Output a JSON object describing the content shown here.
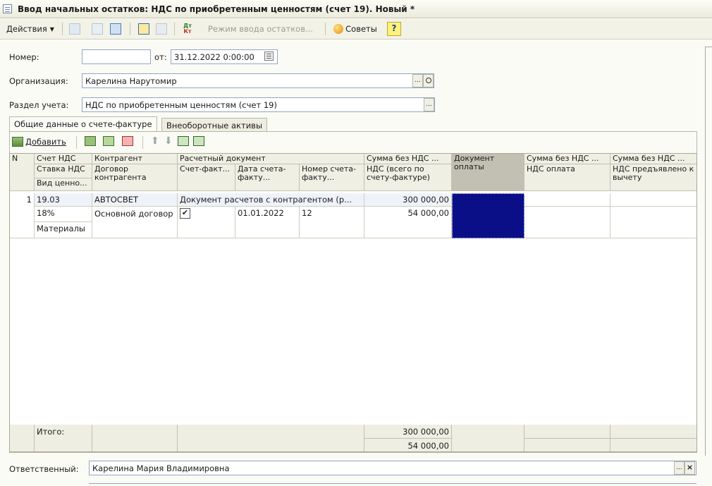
{
  "window": {
    "title": "Ввод начальных остатков: НДС по приобретенным ценностям (счет 19). Новый *"
  },
  "toolbar": {
    "actions_label": "Действия",
    "input_mode_label": "Режим ввода остатков...",
    "tips_label": "Советы",
    "help_label": "?",
    "dtkt_top": "Дт",
    "dtkt_bottom": "Кт"
  },
  "form": {
    "number_label": "Номер:",
    "number_value": "",
    "date_label": "от:",
    "date_value": "31.12.2022  0:00:00",
    "org_label": "Организация:",
    "org_value": "Карелина Нарутомир",
    "section_label": "Раздел учета:",
    "section_value": "НДС по приобретенным ценностям (счет 19)",
    "responsible_label": "Ответственный:",
    "responsible_value": "Карелина Мария Владимировна",
    "select_glyph": "...",
    "clear_glyph": "×"
  },
  "tabs": [
    {
      "label": "Общие данные о счете-фактуре"
    },
    {
      "label": "Внеоборотные активы"
    }
  ],
  "grid_toolbar": {
    "add_label": "Добавить"
  },
  "grid": {
    "headers": {
      "n": "N",
      "account": "Счет НДС",
      "rate": "Ставка НДС",
      "valuable_type": "Вид ценно...",
      "counterparty": "Контрагент",
      "contract": "Договор контрагента",
      "settlement_doc": "Расчетный документ",
      "invoice": "Счет-факт...",
      "invoice_date": "Дата счета-факту...",
      "invoice_number": "Номер счета-факту...",
      "sum_no_vat": "Сумма без НДС ...",
      "vat_total": "НДС (всего по счету-фактуре)",
      "payment_doc": "Документ оплаты",
      "sum_no_vat_2": "Сумма без НДС ...",
      "vat_payment": "НДС оплата",
      "sum_no_vat_3": "Сумма без НДС ...",
      "vat_deduct": "НДС предъявлено к вычету"
    },
    "rows": [
      {
        "n": "1",
        "account": "19.03",
        "rate": "18%",
        "valuable_type": "Материалы",
        "counterparty": "АВТОСВЕТ",
        "contract": "Основной договор",
        "settlement_doc": "Документ расчетов с контрагентом (р...",
        "invoice_checked": "✔",
        "invoice_date": "01.01.2022",
        "invoice_number": "12",
        "sum_no_vat": "300 000,00",
        "vat_total": "54 000,00"
      }
    ],
    "totals": {
      "label": "Итого:",
      "sum_no_vat": "300 000,00",
      "vat_total": "54 000,00"
    }
  },
  "colors": {
    "selection": "#0a0f88",
    "header_bg": "#f0efe4",
    "field_border": "#8fa7c4"
  },
  "icons": [
    "form-icon",
    "dropdown-arrow-icon",
    "back-icon",
    "copy-icon",
    "refresh-icon",
    "post-icon",
    "unpost-icon",
    "dt-kt-icon",
    "tips-icon",
    "help-icon",
    "calendar-icon",
    "search-icon",
    "add-row-icon",
    "copy-row-icon",
    "edit-row-icon",
    "delete-row-icon",
    "move-up-icon",
    "move-down-icon",
    "sort-asc-icon",
    "sort-desc-icon"
  ]
}
